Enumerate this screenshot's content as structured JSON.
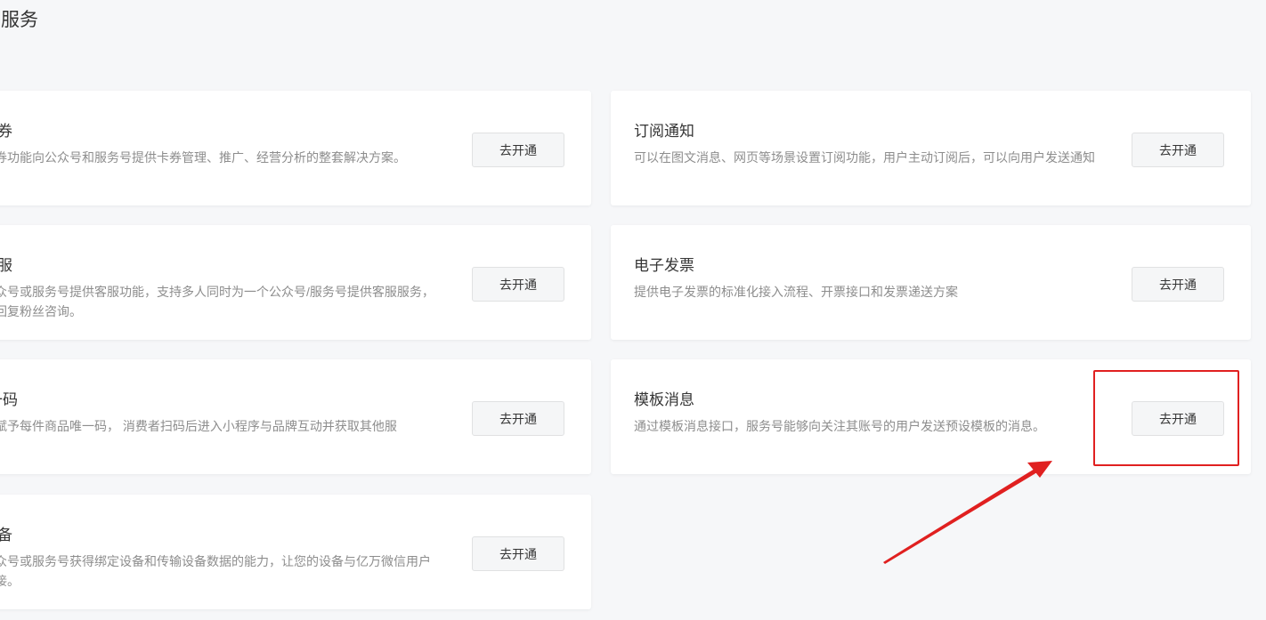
{
  "page": {
    "title": "与服务"
  },
  "cards": [
    {
      "id": "card",
      "title": "卡券",
      "description": "卡券功能向公众号和服务号提供卡券管理、推广、经营分析的整套解决方案。",
      "button_label": "去开通"
    },
    {
      "id": "subscribe",
      "title": "订阅通知",
      "description": "可以在图文消息、网页等场景设置订阅功能，用户主动订阅后，可以向用户发送通知",
      "button_label": "去开通"
    },
    {
      "id": "service",
      "title": "客服",
      "description": "为公众号或服务号提供客服功能，支持多人同时为一个公众号/服务号提供客服服务，实时回复粉丝咨询。",
      "button_label": "去开通"
    },
    {
      "id": "invoice",
      "title": "电子发票",
      "description": "提供电子发票的标准化接入流程、开票接口和发票递送方案",
      "button_label": "去开通"
    },
    {
      "id": "onecode",
      "title": "一物一码",
      "description": "品牌赋予每件商品唯一码， 消费者扫码后进入小程序与品牌互动并获取其他服",
      "button_label": "去开通"
    },
    {
      "id": "template",
      "title": "模板消息",
      "description": "通过模板消息接口，服务号能够向关注其账号的用户发送预设模板的消息。",
      "button_label": "去开通"
    },
    {
      "id": "device",
      "title": "设备",
      "description": "为公众号或服务号获得绑定设备和传输设备数据的能力，让您的设备与亿万微信用户相连接。",
      "button_label": "去开通"
    }
  ],
  "annotation": {
    "color": "#e02020"
  }
}
